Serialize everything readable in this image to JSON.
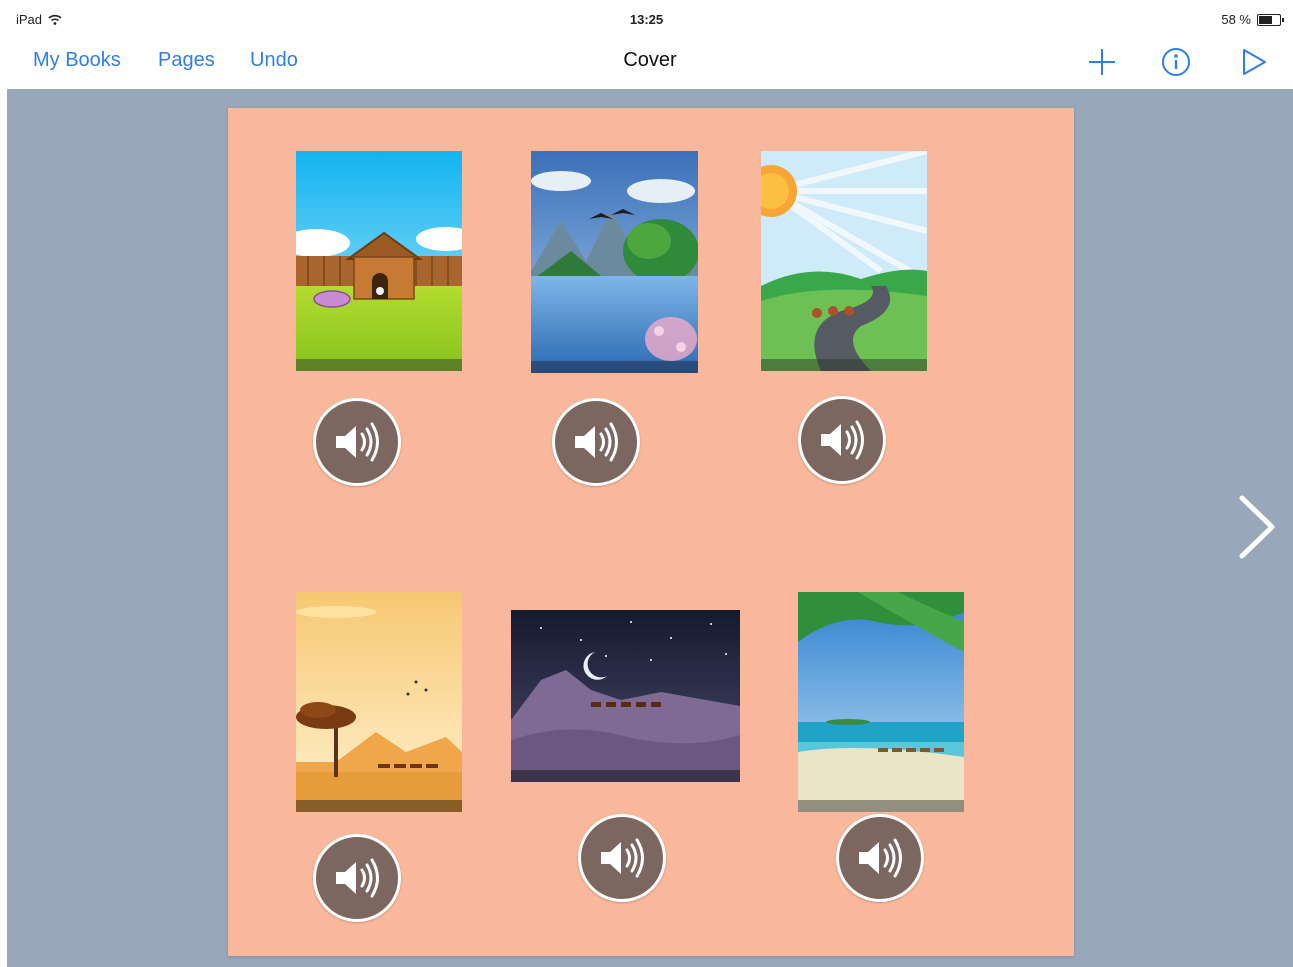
{
  "status_bar": {
    "device": "iPad",
    "time": "13:25",
    "battery": "58 %",
    "battery_level": 0.58
  },
  "nav": {
    "my_books": "My Books",
    "pages": "Pages",
    "undo": "Undo",
    "title": "Cover",
    "icons": [
      "add-icon",
      "info-icon",
      "play-icon"
    ],
    "accent_color": "#2f7fe4"
  },
  "page": {
    "background_color": "#f9b89c",
    "canvas_color": "#98a8ba",
    "thumbnails": [
      {
        "scene": "doghouse-garden"
      },
      {
        "scene": "lake-with-birds"
      },
      {
        "scene": "sun-and-road"
      },
      {
        "scene": "savanna-sunset"
      },
      {
        "scene": "night-desert"
      },
      {
        "scene": "tropical-beach"
      }
    ],
    "speaker_icon": "speaker-icon",
    "speaker_color": "#7b6760"
  },
  "navigation": {
    "next_icon": "chevron-right-icon"
  }
}
